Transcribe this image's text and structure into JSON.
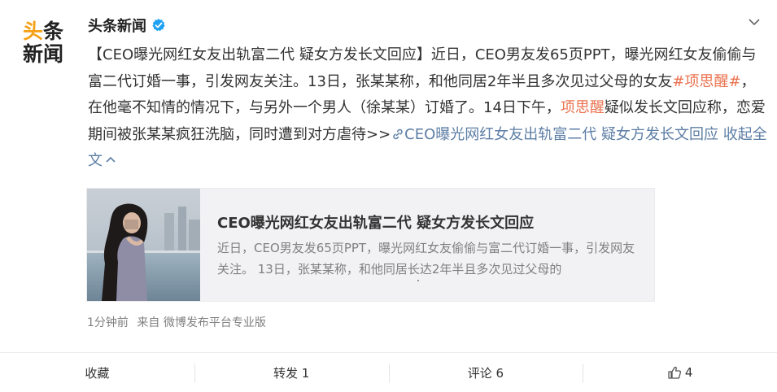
{
  "avatar": {
    "line1_a": "头",
    "line1_b": "条",
    "line2": "新闻"
  },
  "author": {
    "name": "头条新闻"
  },
  "post": {
    "p1": "【CEO曝光网红女友出轨富二代 疑女方发长文回应】近日，CEO男友发65页PPT，曝光网红女友偷偷与富二代订婚一事，引发网友关注。13日，张某某称，和他同居2年半且多次见过父母的女友",
    "hashtag": "#项思醒#",
    "p2": "，在他毫不知情的情况下，与另外一个男人（徐某某）订婚了。14日下午，",
    "mention": "项思醒",
    "p3": "疑似发长文回应称，恋爱期间被张某某疯狂洗脑，同时遭到对方虐待>>",
    "link_icon": "🔗",
    "link_text": "CEO曝光网红女友出轨富二代 疑女方发长文回应",
    "collapse": " 收起全文",
    "collapse_icon": "chevron-up-icon"
  },
  "card": {
    "title": "CEO曝光网红女友出轨富二代 疑女方发长文回应",
    "desc": "近日，CEO男友发65页PPT，曝光网红女友偷偷与富二代订婚一事，引发网友关注。 13日，张某某称，和他同居长达2年半且多次见过父母的"
  },
  "meta": {
    "time": "1分钟前",
    "source": "来自 微博发布平台专业版"
  },
  "actions": {
    "favorite": "收藏",
    "repost": "转发 1",
    "comment": "评论 6",
    "like_count": "4"
  },
  "colors": {
    "link": "#5d7ea5",
    "topic": "#eb7350",
    "verified": "#1da1f2"
  }
}
